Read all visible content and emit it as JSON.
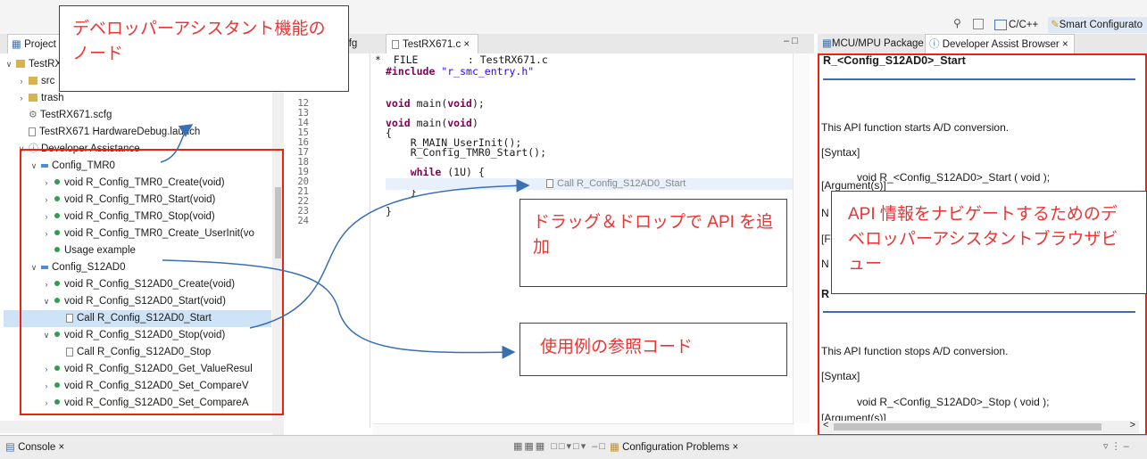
{
  "toolbar": {
    "cpp_label": "C/C++",
    "smart_label": "Smart Configurato"
  },
  "left_panel": {
    "tab_label": "Project",
    "tree": [
      {
        "label": "TestRX671",
        "kind": "project"
      },
      {
        "label": "src",
        "kind": "folder"
      },
      {
        "label": "trash",
        "kind": "folder"
      },
      {
        "label": "TestRX671.scfg",
        "kind": "scfg"
      },
      {
        "label": "TestRX671 HardwareDebug.launch",
        "kind": "file"
      },
      {
        "label": "Developer Assistance",
        "kind": "assist"
      },
      {
        "label": "Config_TMR0",
        "kind": "config"
      },
      {
        "label": "void R_Config_TMR0_Create(void)",
        "kind": "fn"
      },
      {
        "label": "void R_Config_TMR0_Start(void)",
        "kind": "fn"
      },
      {
        "label": "void R_Config_TMR0_Stop(void)",
        "kind": "fn"
      },
      {
        "label": "void R_Config_TMR0_Create_UserInit(vo",
        "kind": "fn"
      },
      {
        "label": "Usage example",
        "kind": "fn"
      },
      {
        "label": "Config_S12AD0",
        "kind": "config"
      },
      {
        "label": "void R_Config_S12AD0_Create(void)",
        "kind": "fn"
      },
      {
        "label": "void R_Config_S12AD0_Start(void)",
        "kind": "fn"
      },
      {
        "label": "Call R_Config_S12AD0_Start",
        "kind": "call"
      },
      {
        "label": "void R_Config_S12AD0_Stop(void)",
        "kind": "fn"
      },
      {
        "label": "Call R_Config_S12AD0_Stop",
        "kind": "call"
      },
      {
        "label": "void R_Config_S12AD0_Get_ValueResul",
        "kind": "fn"
      },
      {
        "label": "void R_Config_S12AD0_Set_CompareV",
        "kind": "fn"
      },
      {
        "label": "void R_Config_S12AD0_Set_CompareA",
        "kind": "fn"
      }
    ]
  },
  "editor": {
    "tab_scfg": ".scfg",
    "tab_c": "TestRX671.c",
    "header_lines": [
      "*  FILE        : TestRX671.c",
      "#include \"r_smc_entry.h\""
    ],
    "line_numbers": [
      "12",
      "13",
      "14",
      "15",
      "16",
      "17",
      "18",
      "19",
      "20",
      "21",
      "22",
      "23",
      "24"
    ],
    "lines": [
      "void main(void);",
      "",
      "void main(void)",
      "{",
      "    R_MAIN_UserInit();",
      "    R_Config_TMR0_Start();",
      "",
      "    while (1U) {",
      "        ;",
      "    }",
      "",
      "}",
      ""
    ],
    "drag_hint": "Call R_Config_S12AD0_Start"
  },
  "right_panel": {
    "tab_mcu": "MCU/MPU Package",
    "tab_browser": "Developer Assist Browser",
    "heading1": "R_<Config_S12AD0>_Start",
    "desc1": "This API function starts A/D conversion.",
    "syntax_label": "[Syntax]",
    "syntax1": "void R_<Config_S12AD0>_Start ( void );",
    "arguments_label": "[Argument(s)]",
    "partial_n1": "N",
    "partial_r": "[F",
    "partial_n2": "N",
    "partial_heading": "R",
    "desc2": "This API function stops A/D conversion.",
    "syntax2": "void R_<Config_S12AD0>_Stop ( void );",
    "arguments_label2": "[Argument(s)]"
  },
  "bottom": {
    "console_tab": "Console",
    "problems_tab": "Configuration Problems"
  },
  "annotations": {
    "node_label": "デベロッパーアシスタント機能のノード",
    "dragdrop_label": "ドラッグ＆ドロップで API を追加",
    "usage_label": "使用例の参照コード",
    "browser_label": "API 情報をナビゲートするためのデベロッパーアシスタントブラウザビュー"
  },
  "colors": {
    "annotation_red": "#e22222",
    "arrow_blue": "#3a6fb4"
  }
}
